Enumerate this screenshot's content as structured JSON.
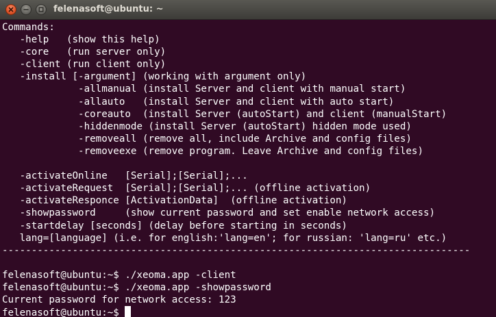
{
  "window": {
    "title": "felenasoft@ubuntu: ~"
  },
  "terminal": {
    "lines": [
      "Commands:",
      "   -help   (show this help)",
      "   -core   (run server only)",
      "   -client (run client only)",
      "   -install [-argument] (working with argument only)",
      "             -allmanual (install Server and client with manual start)",
      "             -allauto   (install Server and client with auto start)",
      "             -coreauto  (install Server (autoStart) and client (manualStart)",
      "             -hiddenmode (install Server (autoStart) hidden mode used)",
      "             -removeall (remove all, include Archive and config files)",
      "             -removeexe (remove program. Leave Archive and config files)",
      "",
      "   -activateOnline   [Serial];[Serial];...",
      "   -activateRequest  [Serial];[Serial];... (offline activation)",
      "   -activateResponce [ActivationData]  (offline activation)",
      "   -showpassword     (show current password and set enable network access)",
      "   -startdelay [seconds] (delay before starting in seconds)",
      "   lang=[language] (i.e. for english:'lang=en'; for russian: 'lang=ru' etc.)",
      "--------------------------------------------------------------------------------",
      "",
      "felenasoft@ubuntu:~$ ./xeoma.app -client",
      "felenasoft@ubuntu:~$ ./xeoma.app -showpassword",
      "Current password for network access: 123"
    ],
    "prompt": "felenasoft@ubuntu:~$ "
  },
  "colors": {
    "terminal_background": "#300a24",
    "terminal_text": "#ffffff",
    "titlebar": "#3d3c38",
    "close_button": "#e2572c"
  },
  "icons": {
    "close": "close-icon",
    "minimize": "minimize-icon",
    "maximize": "maximize-icon"
  }
}
